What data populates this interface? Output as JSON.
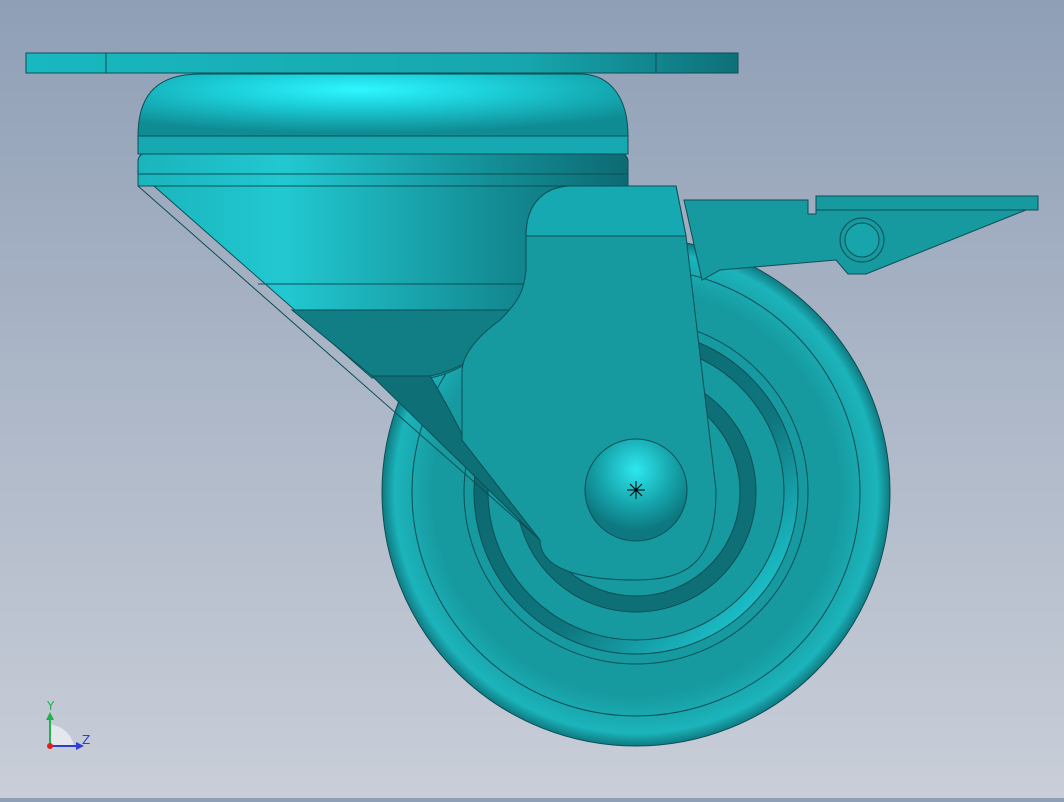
{
  "view": {
    "background_top": "#8f9fb6",
    "background_bottom": "#c9ced8",
    "part_color": "#169aa0",
    "highlight_color": "#1ff0ff"
  },
  "triad": {
    "y_label": "Y",
    "z_label": "Z",
    "y_color": "#22b14c",
    "z_color": "#2b3fd6"
  },
  "icons": {
    "origin": "origin-star-icon",
    "triad": "coordinate-triad-icon"
  }
}
